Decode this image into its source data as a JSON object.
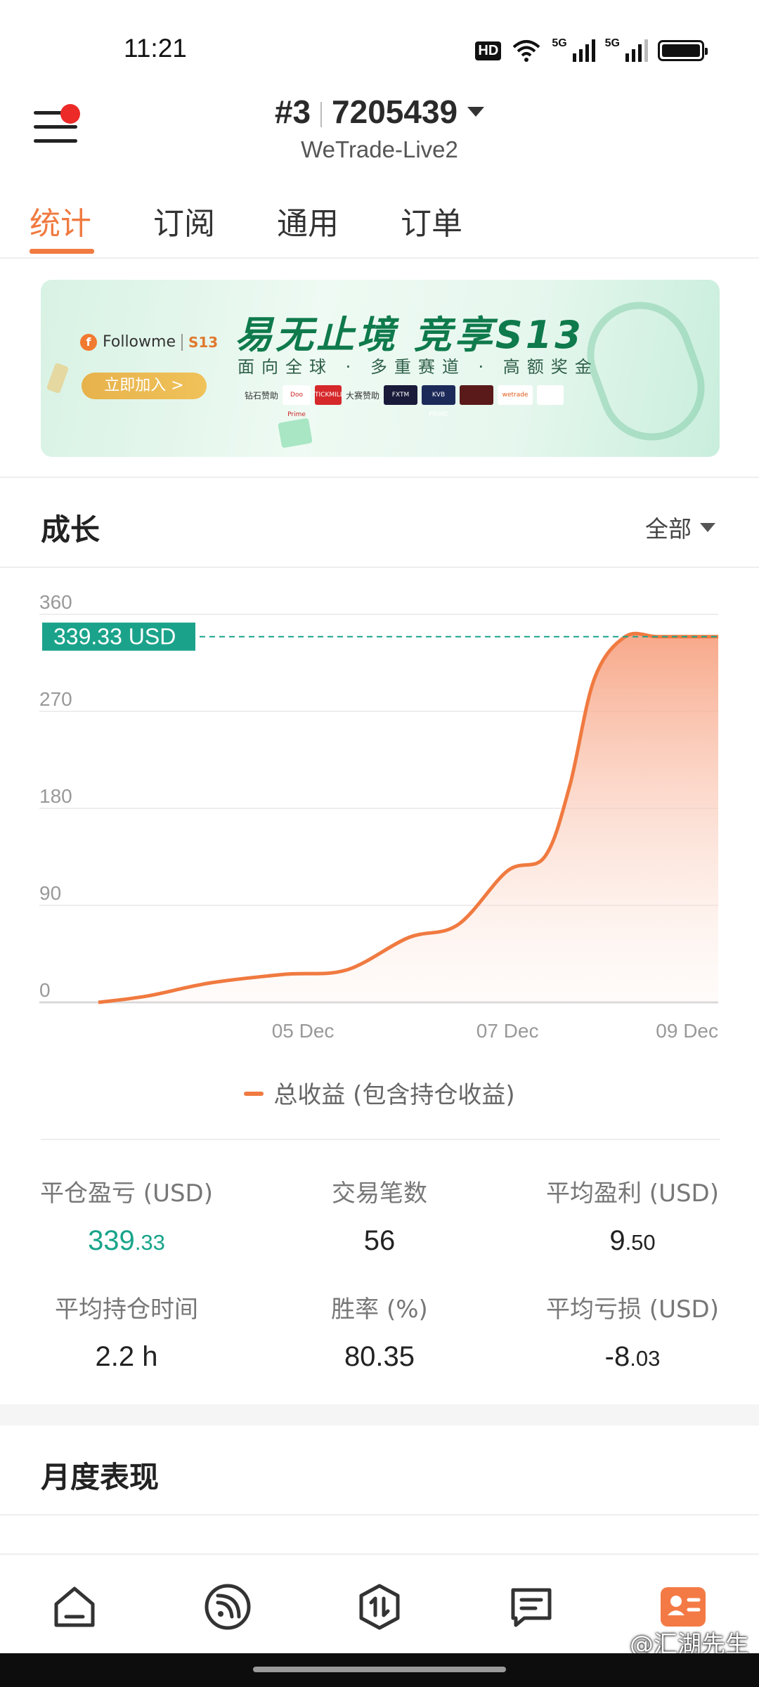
{
  "status_bar": {
    "time": "11:21",
    "hd_badge": "HD",
    "network_1": "5G",
    "network_2": "5G"
  },
  "header": {
    "account_index": "#3",
    "account_number": "7205439",
    "server": "WeTrade-Live2",
    "menu_has_notification": true
  },
  "tabs": [
    {
      "label": "统计",
      "active": true
    },
    {
      "label": "订阅",
      "active": false
    },
    {
      "label": "通用",
      "active": false
    },
    {
      "label": "订单",
      "active": false
    }
  ],
  "banner": {
    "brand": "Followme",
    "brand_tag": "S13",
    "join_label": "立即加入 >",
    "title": "易无止境 竞享S13",
    "subtitle": "面向全球 · 多重赛道 · 高额奖金",
    "diamond_sponsor_label": "钻石赞助",
    "event_sponsor_label": "大赛赞助",
    "sponsors": [
      "Doo Prime",
      "TICKMILL",
      "FXTM",
      "KVB PRIME",
      "wetrade"
    ]
  },
  "growth": {
    "title": "成长",
    "filter_label": "全部",
    "legend_label": "总收益 (包含持仓收益)"
  },
  "chart_data": {
    "type": "area",
    "current_value_label": "339.33 USD",
    "current_value": 339.33,
    "y_ticks": [
      "0",
      "90",
      "180",
      "270",
      "360"
    ],
    "ylim": [
      0,
      360
    ],
    "x_ticks": [
      "05 Dec",
      "07 Dec",
      "09 Dec"
    ],
    "series": [
      {
        "name": "总收益 (包含持仓收益)",
        "color": "#f07a40",
        "x": [
          0,
          0.08,
          0.18,
          0.3,
          0.4,
          0.5,
          0.58,
          0.66,
          0.72,
          0.76,
          0.8,
          0.85,
          0.9,
          0.95,
          1.0
        ],
        "values": [
          0,
          6,
          18,
          26,
          30,
          60,
          72,
          122,
          135,
          200,
          300,
          339.33,
          339.33,
          339.33,
          339.33
        ]
      }
    ],
    "colors": {
      "line": "#f07a40",
      "fill_top": "#f7a383",
      "marker": "#1aa38a"
    }
  },
  "stats": [
    {
      "label": "平仓盈亏 (USD)",
      "int": "339",
      "dec": ".33",
      "green": true
    },
    {
      "label": "交易笔数",
      "int": "56",
      "dec": "",
      "green": false
    },
    {
      "label": "平均盈利 (USD)",
      "int": "9",
      "dec": ".50",
      "green": false
    },
    {
      "label": "平均持仓时间",
      "int": "2.2 h",
      "dec": "",
      "green": false
    },
    {
      "label": "胜率 (%)",
      "int": "80.35",
      "dec": "",
      "green": false
    },
    {
      "label": "平均亏损 (USD)",
      "int": "-8",
      "dec": ".03",
      "green": false
    }
  ],
  "monthly": {
    "title": "月度表现"
  },
  "bottom_nav": [
    {
      "name": "home",
      "active": false
    },
    {
      "name": "feed",
      "active": false
    },
    {
      "name": "trade",
      "active": false
    },
    {
      "name": "messages",
      "active": false
    },
    {
      "name": "profile",
      "active": true
    }
  ],
  "watermark": "@汇湖先生"
}
